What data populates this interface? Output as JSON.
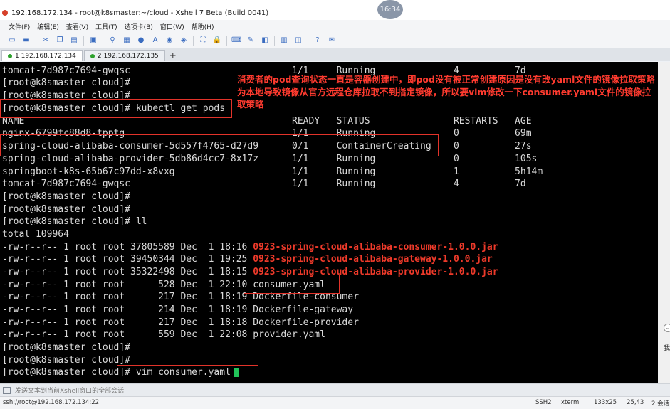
{
  "window": {
    "title": "192.168.172.134 - root@k8smaster:~/cloud - Xshell 7 Beta (Build 0041)",
    "clock": "16:34"
  },
  "menu": [
    "文件(F)",
    "编辑(E)",
    "查看(V)",
    "工具(T)",
    "选项卡(B)",
    "窗口(W)",
    "帮助(H)"
  ],
  "tabs": [
    {
      "label": "1 192.168.172.134",
      "active": true
    },
    {
      "label": "2 192.168.172.135",
      "active": false
    }
  ],
  "terminal": {
    "lines": [
      "tomcat-7d987c7694-gwqsc                             1/1     Running              4          7d",
      "[root@k8smaster cloud]#",
      "[root@k8smaster cloud]#",
      "[root@k8smaster cloud]# kubectl get pods",
      "NAME                                                READY   STATUS               RESTARTS   AGE",
      "nginx-6799fc88d8-tpptg                              1/1     Running              0          69m",
      "spring-cloud-alibaba-consumer-5d557f4765-d27d9      0/1     ContainerCreating    0          27s",
      "spring-cloud-alibaba-provider-5db86d4cc7-8x17z      1/1     Running              0          105s",
      "springboot-k8s-65b67c97dd-x8vxg                     1/1     Running              1          5h14m",
      "tomcat-7d987c7694-gwqsc                             1/1     Running              4          7d",
      "[root@k8smaster cloud]#",
      "[root@k8smaster cloud]#",
      "[root@k8smaster cloud]# ll",
      "total 109964"
    ],
    "files": [
      {
        "perm": "-rw-r--r-- 1 root root 37805589 Dec  1 18:16 ",
        "name": "0923-spring-cloud-alibaba-consumer-1.0.0.jar",
        "red": true
      },
      {
        "perm": "-rw-r--r-- 1 root root 39450344 Dec  1 19:25 ",
        "name": "0923-spring-cloud-alibaba-gateway-1.0.0.jar",
        "red": true
      },
      {
        "perm": "-rw-r--r-- 1 root root 35322498 Dec  1 18:15 ",
        "name": "0923-spring-cloud-alibaba-provider-1.0.0.jar",
        "red": true
      },
      {
        "perm": "-rw-r--r-- 1 root root      528 Dec  1 22:10 ",
        "name": "consumer.yaml",
        "red": false
      },
      {
        "perm": "-rw-r--r-- 1 root root      217 Dec  1 18:19 ",
        "name": "Dockerfile-consumer",
        "red": false
      },
      {
        "perm": "-rw-r--r-- 1 root root      214 Dec  1 18:19 ",
        "name": "Dockerfile-gateway",
        "red": false
      },
      {
        "perm": "-rw-r--r-- 1 root root      217 Dec  1 18:18 ",
        "name": "Dockerfile-provider",
        "red": false
      },
      {
        "perm": "-rw-r--r-- 1 root root      559 Dec  1 22:08 ",
        "name": "provider.yaml",
        "red": false
      }
    ],
    "tail_lines": [
      "[root@k8smaster cloud]#",
      "[root@k8smaster cloud]#",
      "[root@k8smaster cloud]# vim consumer.yaml"
    ]
  },
  "annotation": "消费者的pod查询状态一直是容器创建中，即pod没有被正常创建原因是没有改yaml文件的镜像拉取策略为本地导致镜像从官方远程仓库拉取不到指定镜像，所以要vim修改一下consumer.yaml文件的镜像拉取策略",
  "send_bar": "发送文本到当前Xshell窗口的全部会话",
  "status": {
    "connection": "ssh://root@192.168.172.134:22",
    "protocol": "SSH2",
    "term": "xterm",
    "size": "133x25",
    "cursor_pos": "25,43",
    "sessions": "2 会话"
  }
}
